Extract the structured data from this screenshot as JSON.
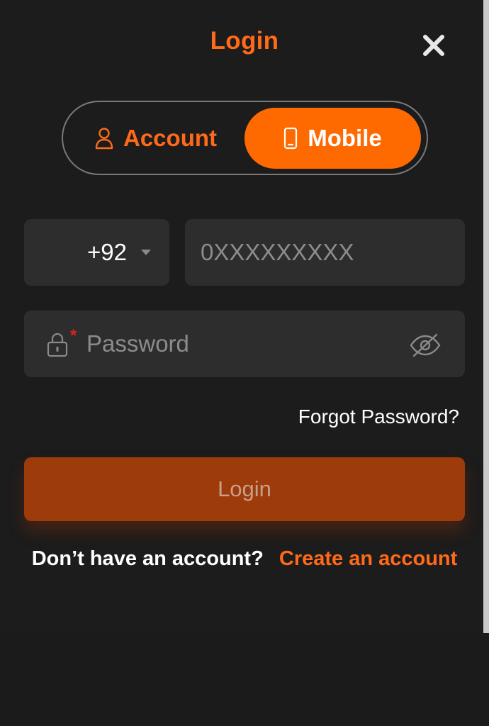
{
  "modal": {
    "title": "Login"
  },
  "tabs": [
    {
      "label": "Account",
      "icon": "user-icon",
      "active": false
    },
    {
      "label": "Mobile",
      "icon": "mobile-phone-icon",
      "active": true
    }
  ],
  "phone": {
    "country_code": "+92",
    "placeholder": "0XXXXXXXXX"
  },
  "password": {
    "placeholder": "Password",
    "required_mark": "*"
  },
  "links": {
    "forgot_password": "Forgot Password?",
    "no_account_text": "Don’t have an account?",
    "create_account": "Create an account"
  },
  "buttons": {
    "login": "Login"
  },
  "colors": {
    "accent": "#ff6a00",
    "background": "#1c1c1c",
    "field": "#2d2d2d",
    "login_button_disabled": "#9e3b0a"
  }
}
